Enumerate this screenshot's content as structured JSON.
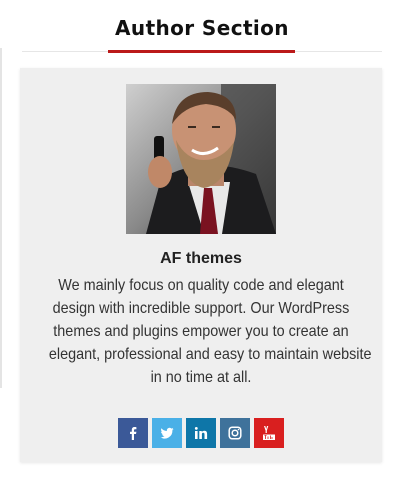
{
  "section": {
    "title": "Author Section"
  },
  "author": {
    "name": "AF themes",
    "bio_lines": [
      "We mainly focus on quality code and elegant",
      "design with incredible support. Our WordPress",
      "themes and plugins empower you to create an",
      "elegant, professional and easy to maintain website",
      "in no time at all."
    ]
  },
  "social": [
    {
      "name": "facebook-icon",
      "color": "#3b5998"
    },
    {
      "name": "twitter-icon",
      "color": "#4ab0e7"
    },
    {
      "name": "linkedin-icon",
      "color": "#0e76a8"
    },
    {
      "name": "instagram-icon",
      "color": "#3f729b"
    },
    {
      "name": "youtube-icon",
      "color": "#d91f1f"
    }
  ],
  "colors": {
    "accent": "#bb1919",
    "card_background": "#efefef"
  }
}
